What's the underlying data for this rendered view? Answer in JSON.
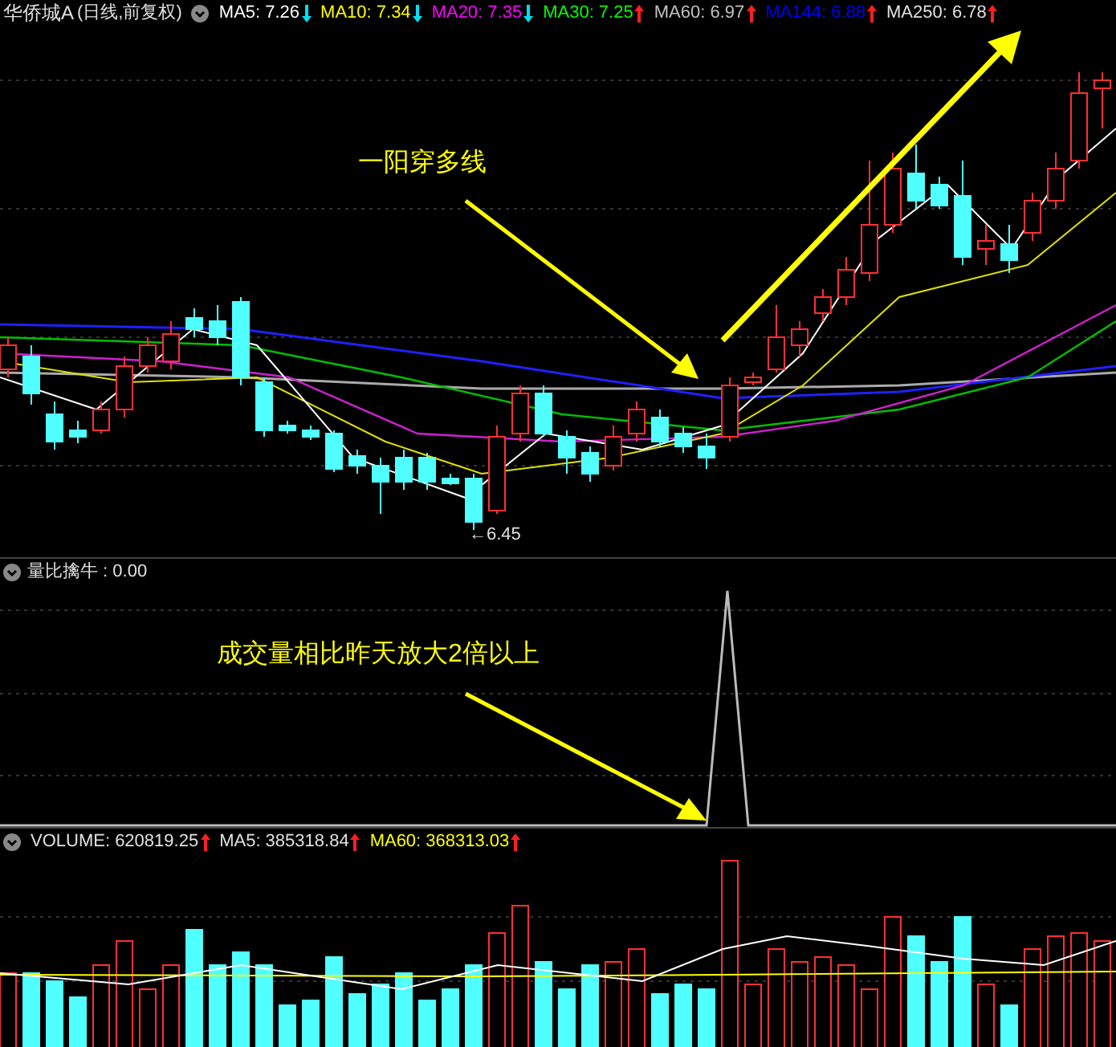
{
  "price_panel": {
    "title": "华侨城A",
    "subtitle": "(日线,前复权)",
    "indicators": [
      {
        "label": "MA5: 7.26",
        "color": "#ffffff",
        "rising": false
      },
      {
        "label": "MA10: 7.34",
        "color": "#ffff00",
        "rising": false
      },
      {
        "label": "MA20: 7.35",
        "color": "#ff00ff",
        "rising": false
      },
      {
        "label": "MA30: 7.25",
        "color": "#00ff00",
        "rising": true
      },
      {
        "label": "MA60: 6.97",
        "color": "#c0c0c0",
        "rising": true
      },
      {
        "label": "MA144: 6.88",
        "color": "#0000ff",
        "rising": true
      },
      {
        "label": "MA250: 6.78",
        "color": "#e0e0e0",
        "rising": true
      }
    ],
    "low_label": "←6.45",
    "annotation": "一阳穿多线"
  },
  "indicator_panel": {
    "title": "量比擒牛 : 0.00",
    "annotation": "成交量相比昨天放大2倍以上"
  },
  "volume_panel": {
    "indicators": [
      {
        "label": "VOLUME: 620819.25",
        "color": "#e0e0e0",
        "rising": true
      },
      {
        "label": "MA5: 385318.84",
        "color": "#e0e0e0",
        "rising": true
      },
      {
        "label": "MA60: 368313.03",
        "color": "#ffff00",
        "rising": true
      }
    ]
  }
}
